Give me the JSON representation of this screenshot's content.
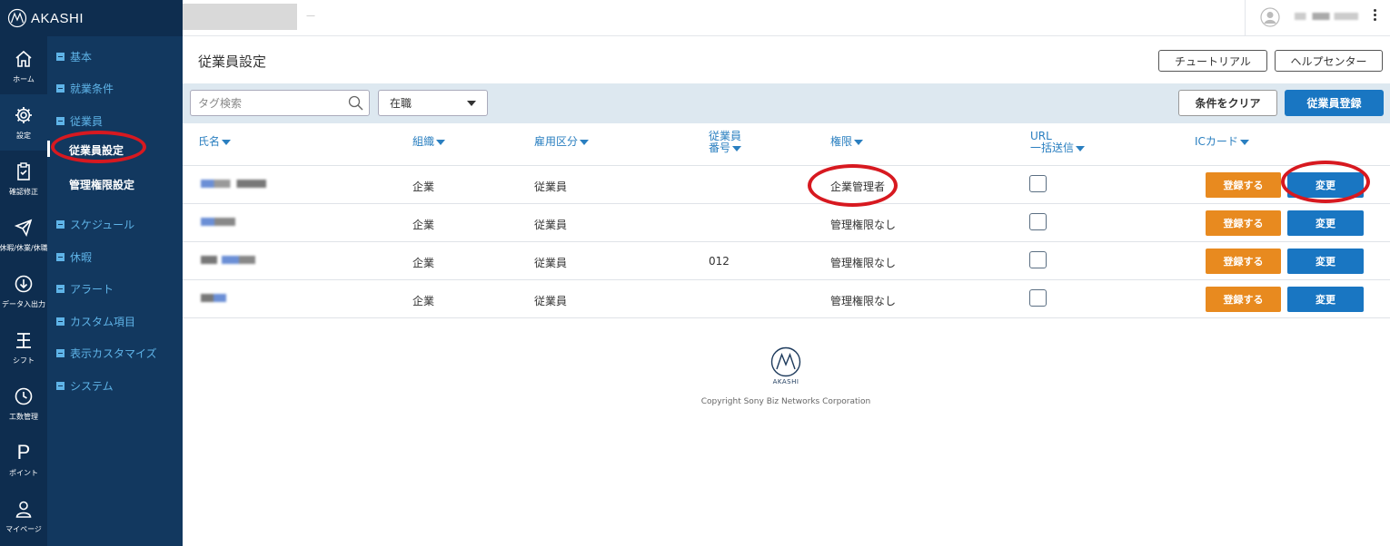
{
  "app": {
    "logo_text": "AKASHI"
  },
  "rail": [
    {
      "label": "ホーム",
      "icon": "home-icon"
    },
    {
      "label": "設定",
      "icon": "gear-icon"
    },
    {
      "label": "確認修正",
      "icon": "clipboard-icon"
    },
    {
      "label": "休暇/休業/休職",
      "icon": "plane-icon"
    },
    {
      "label": "データ入出力",
      "icon": "download-icon"
    },
    {
      "label": "シフト",
      "icon": "shift-icon"
    },
    {
      "label": "工数管理",
      "icon": "clock-icon"
    },
    {
      "label": "ポイント",
      "icon": "p-icon",
      "glyph": "P"
    },
    {
      "label": "マイページ",
      "icon": "person-icon"
    }
  ],
  "subnav": {
    "basic": "基本",
    "work_conditions": "就業条件",
    "employee": "従業員",
    "employee_settings": "従業員設定",
    "admin_permission_settings": "管理権限設定",
    "schedule": "スケジュール",
    "vacation": "休暇",
    "alert": "アラート",
    "custom_items": "カスタム項目",
    "display_customize": "表示カスタマイズ",
    "system": "システム"
  },
  "topbar": {
    "separator": "—"
  },
  "page": {
    "title": "従業員設定",
    "tutorial_label": "チュートリアル",
    "help_center_label": "ヘルプセンター"
  },
  "filters": {
    "tag_search_placeholder": "タグ検索",
    "status_selected": "在職",
    "clear_label": "条件をクリア",
    "register_label": "従業員登録"
  },
  "table": {
    "headers": {
      "name": "氏名",
      "organization": "組織",
      "employment_type": "雇用区分",
      "employee_number_line1": "従業員",
      "employee_number_line2": "番号",
      "permission": "権限",
      "url_line1": "URL",
      "url_line2": "一括送信",
      "ic_card": "ICカード"
    },
    "rows": [
      {
        "organization": "企業",
        "employment_type": "従業員",
        "employee_number": "",
        "permission": "企業管理者",
        "url_checked": false
      },
      {
        "organization": "企業",
        "employment_type": "従業員",
        "employee_number": "",
        "permission": "管理権限なし",
        "url_checked": false
      },
      {
        "organization": "企業",
        "employment_type": "従業員",
        "employee_number": "012",
        "permission": "管理権限なし",
        "url_checked": false
      },
      {
        "organization": "企業",
        "employment_type": "従業員",
        "employee_number": "",
        "permission": "管理権限なし",
        "url_checked": false
      }
    ],
    "register_button_label": "登録する",
    "change_button_label": "変更"
  },
  "footer": {
    "brand": "AKASHI",
    "copyright": "Copyright Sony Biz Networks Corporation"
  },
  "colors": {
    "sidebar_dark": "#0e2d4f",
    "sidebar_sub": "#12385f",
    "nav_link": "#5fb4e8",
    "primary_blue": "#1976c2",
    "orange": "#e88a1f",
    "highlight_red": "#d71920"
  }
}
